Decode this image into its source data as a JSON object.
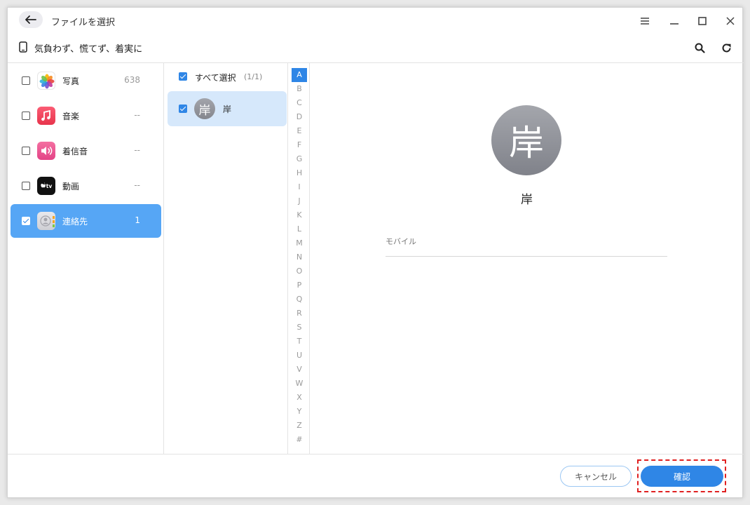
{
  "window": {
    "title": "ファイルを選択"
  },
  "device": {
    "name": "気負わず、慌てず、着実に"
  },
  "categories": [
    {
      "label": "写真",
      "count": "638",
      "checked": false,
      "icon": "photos-icon"
    },
    {
      "label": "音楽",
      "count": "--",
      "checked": false,
      "icon": "music-icon"
    },
    {
      "label": "着信音",
      "count": "--",
      "checked": false,
      "icon": "ringtone-icon"
    },
    {
      "label": "動画",
      "count": "--",
      "checked": false,
      "icon": "appletv-icon"
    },
    {
      "label": "連絡先",
      "count": "1",
      "checked": true,
      "icon": "contacts-icon"
    }
  ],
  "apple_tv_text": "tv",
  "list": {
    "select_all_label": "すべて選択",
    "select_all_count": "(1/1)",
    "contacts": [
      {
        "avatar": "岸",
        "name": "岸",
        "checked": true
      }
    ]
  },
  "alphabet": [
    "A",
    "B",
    "C",
    "D",
    "E",
    "F",
    "G",
    "H",
    "I",
    "J",
    "K",
    "L",
    "M",
    "N",
    "O",
    "P",
    "Q",
    "R",
    "S",
    "T",
    "U",
    "V",
    "W",
    "X",
    "Y",
    "Z",
    "#"
  ],
  "alphabet_active": "A",
  "detail": {
    "avatar": "岸",
    "name": "岸",
    "field_label": "モバイル"
  },
  "footer": {
    "cancel_label": "キャンセル",
    "confirm_label": "確認"
  },
  "colors": {
    "accent": "#2f86e6",
    "sidebar_active": "#56a6f5",
    "row_selected": "#d6e8fb",
    "highlight": "#e02020"
  }
}
